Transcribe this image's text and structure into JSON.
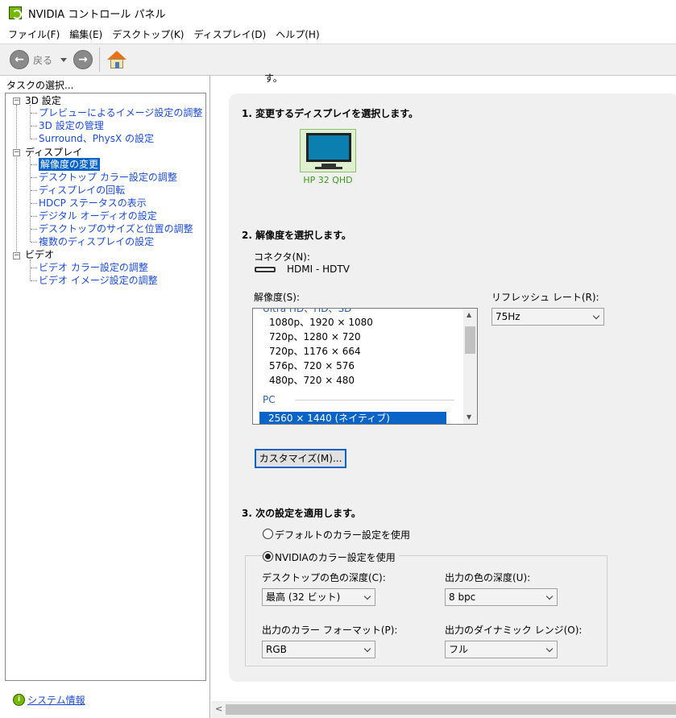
{
  "window": {
    "title": "NVIDIA コントロール パネル"
  },
  "menu": [
    "ファイル(F)",
    "編集(E)",
    "デスクトップ(K)",
    "ディスプレイ(D)",
    "ヘルプ(H)"
  ],
  "toolbar": {
    "back_label": "戻る"
  },
  "sidebar": {
    "header": "タスクの選択...",
    "tree": [
      {
        "label": "3D 設定",
        "children": [
          "プレビューによるイメージ設定の調整",
          "3D 設定の管理",
          "Surround、PhysX の設定"
        ]
      },
      {
        "label": "ディスプレイ",
        "children": [
          "解像度の変更",
          "デスクトップ カラー設定の調整",
          "ディスプレイの回転",
          "HDCP ステータスの表示",
          "デジタル オーディオの設定",
          "デスクトップのサイズと位置の調整",
          "複数のディスプレイの設定"
        ]
      },
      {
        "label": "ビデオ",
        "children": [
          "ビデオ カラー設定の調整",
          "ビデオ イメージ設定の調整"
        ]
      }
    ],
    "selected_item": "解像度の変更",
    "system_info_link": "システム情報"
  },
  "main": {
    "top_fragment": "す。",
    "section1": {
      "title": "1. 変更するディスプレイを選択します。",
      "display_name": "HP 32 QHD"
    },
    "section2": {
      "title": "2. 解像度を選択します。",
      "connector_label": "コネクタ(N):",
      "connector_value": "HDMI - HDTV",
      "resolution_label": "解像度(S):",
      "partial_group": "Ultra HD、HD、SD",
      "resolutions": [
        "1080p、1920 × 1080",
        "720p、1280 × 720",
        "720p、1176 × 664",
        "576p、720 × 576",
        "480p、720 × 480"
      ],
      "pc_group": "PC",
      "selected_resolution": "2560 × 1440 (ネイティブ)",
      "refresh_label": "リフレッシュ レート(R):",
      "refresh_value": "75Hz",
      "customize_button": "カスタマイズ(M)..."
    },
    "section3": {
      "title": "3. 次の設定を適用します。",
      "radio_default": "デフォルトのカラー設定を使用",
      "radio_nvidia": "NVIDIAのカラー設定を使用",
      "desktop_depth_label": "デスクトップの色の深度(C):",
      "desktop_depth_value": "最高 (32 ビット)",
      "output_depth_label": "出力の色の深度(U):",
      "output_depth_value": "8 bpc",
      "output_format_label": "出力のカラー フォーマット(P):",
      "output_format_value": "RGB",
      "dynamic_range_label": "出力のダイナミック レンジ(O):",
      "dynamic_range_value": "フル"
    }
  }
}
